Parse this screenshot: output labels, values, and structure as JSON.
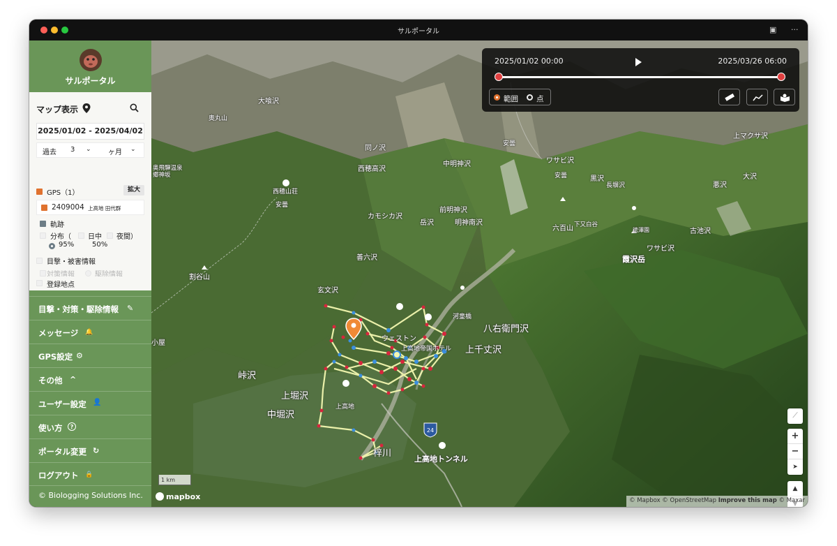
{
  "window": {
    "title": "サルポータル"
  },
  "sidebar": {
    "app_name": "サルポータル",
    "panel": {
      "title": "マップ表示",
      "date_range": "2025/01/02 - 2025/04/02",
      "period_prefix": "過去",
      "period_value": "3",
      "period_unit": "ヶ月",
      "gps_label": "GPS（1）",
      "expand_label": "拡大",
      "device_id": "2409004",
      "device_name": "上高地 田代群",
      "track_label": "軌跡",
      "distribution_label": "分布（",
      "daytime_label": "日中",
      "night_label": "夜間）",
      "pct_95": "95%",
      "pct_50": "50%",
      "sighting_label": "目撃・被害情報",
      "measures_label": "対策情報",
      "removal_label": "駆除情報",
      "registered_label": "登録地点"
    },
    "menu": [
      {
        "label": "目撃・対策・駆除情報",
        "icon": "✎"
      },
      {
        "label": "メッセージ",
        "icon": "🔔"
      },
      {
        "label": "GPS設定",
        "icon": "⚙"
      },
      {
        "label": "その他",
        "icon": "^"
      },
      {
        "label": "ユーザー設定",
        "icon": "👤"
      },
      {
        "label": "使い方",
        "icon": "?"
      },
      {
        "label": "ポータル変更",
        "icon": "↻"
      },
      {
        "label": "ログアウト",
        "icon": "🔒"
      }
    ],
    "copyright": "© Biologging Solutions Inc."
  },
  "timeline": {
    "start": "2025/01/02 00:00",
    "end": "2025/03/26 06:00",
    "progress": 1.0,
    "mode_range": "範囲",
    "mode_point": "点"
  },
  "map": {
    "labels": [
      "大喰沢",
      "奥丸山",
      "同ノ沢",
      "西穂高沢",
      "西穂山荘",
      "安曇",
      "奥飛騨温泉郷神坂",
      "カモシカ沢",
      "善六沢",
      "玄文沢",
      "割谷山",
      "小屋",
      "峠沢",
      "上堀沢",
      "中堀沢",
      "上高地",
      "上高地トンネル",
      "梓川",
      "ウェストン",
      "上高地帝国ホテル",
      "上千丈沢",
      "八右衛門沢",
      "河童橋",
      "岳沢",
      "前明神沢",
      "明神南沢",
      "中明神沢",
      "安曇",
      "ワサビ沢",
      "黒沢",
      "安曇",
      "長塀沢",
      "六百山",
      "下又白谷",
      "徳澤園",
      "霞沢岳",
      "ワサビ沢",
      "古池沢",
      "悪沢",
      "大沢",
      "上マクサ沢",
      "梓川",
      "24"
    ],
    "scale": "1 km",
    "logo": "mapbox",
    "attribution": "© Mapbox © OpenStreetMap",
    "improve": "Improve this map",
    "maxar": "© Maxar",
    "controls": {
      "zoom_in": "+",
      "zoom_out": "−",
      "up": "▲",
      "down": "▼"
    }
  },
  "colors": {
    "sidebar": "#6a9658",
    "accent": "#e0722f",
    "track": "#f3f7b0",
    "point_red": "#d7263d",
    "point_blue": "#3b8fe0"
  }
}
